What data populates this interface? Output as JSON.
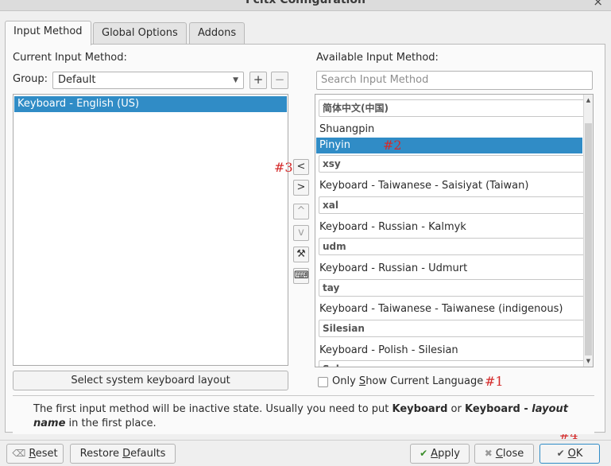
{
  "window": {
    "title": "Fcitx Configuration",
    "close_glyph": "×"
  },
  "tabs": [
    "Input Method",
    "Global Options",
    "Addons"
  ],
  "left": {
    "heading": "Current Input Method:",
    "group_label": "Group:",
    "group_value": "Default",
    "add_glyph": "+",
    "remove_glyph": "−",
    "items": [
      "Keyboard - English (US)"
    ],
    "select_layout_button": "Select system keyboard layout"
  },
  "right": {
    "heading": "Available Input Method:",
    "search_placeholder": "Search Input Method",
    "list": [
      {
        "kind": "header",
        "text": "简体中文(中国)"
      },
      {
        "kind": "item",
        "text": "Shuangpin"
      },
      {
        "kind": "item",
        "text": "Pinyin",
        "selected": true
      },
      {
        "kind": "header",
        "text": "xsy"
      },
      {
        "kind": "item",
        "text": "Keyboard - Taiwanese - Saisiyat (Taiwan)"
      },
      {
        "kind": "header",
        "text": "xal"
      },
      {
        "kind": "item",
        "text": "Keyboard - Russian - Kalmyk"
      },
      {
        "kind": "header",
        "text": "udm"
      },
      {
        "kind": "item",
        "text": "Keyboard - Russian - Udmurt"
      },
      {
        "kind": "header",
        "text": "tay"
      },
      {
        "kind": "item",
        "text": "Keyboard - Taiwanese - Taiwanese (indigenous)"
      },
      {
        "kind": "header",
        "text": "Silesian"
      },
      {
        "kind": "item",
        "text": "Keyboard - Polish - Silesian"
      },
      {
        "kind": "header",
        "text": "Sala"
      }
    ],
    "only_show_current_language": {
      "before": "Only ",
      "mnemonic": "S",
      "after": "how Current Language",
      "checked": false
    }
  },
  "middle_buttons": [
    {
      "name": "move-left-button",
      "glyph": "<",
      "enabled": true
    },
    {
      "name": "move-right-button",
      "glyph": ">",
      "enabled": true
    },
    {
      "name": "move-up-button",
      "glyph": "^",
      "enabled": false
    },
    {
      "name": "move-down-button",
      "glyph": "v",
      "enabled": false
    },
    {
      "name": "configure-button",
      "glyph": "⚒",
      "enabled": true
    },
    {
      "name": "keyboard-layout-button",
      "glyph": "⌨",
      "enabled": true
    }
  ],
  "annotations": [
    "#1",
    "#2",
    "#3",
    "#4"
  ],
  "info": {
    "p1": "The first input method will be inactive state. Usually you need to put ",
    "b1": "Keyboard",
    "p2": " or ",
    "b2": "Keyboard - ",
    "i1": "layout name",
    "p3": " in the first place."
  },
  "footer": {
    "reset": {
      "mnemonic": "R",
      "rest": "eset"
    },
    "restore": {
      "before": "Restore ",
      "mnemonic": "D",
      "rest": "efaults"
    },
    "apply": {
      "mnemonic": "A",
      "rest": "pply"
    },
    "close": {
      "mnemonic": "C",
      "rest": "lose"
    },
    "ok": {
      "mnemonic": "O",
      "rest": "K"
    }
  },
  "colors": {
    "selection": "#308cc6",
    "annotation": "#d42a2a"
  }
}
